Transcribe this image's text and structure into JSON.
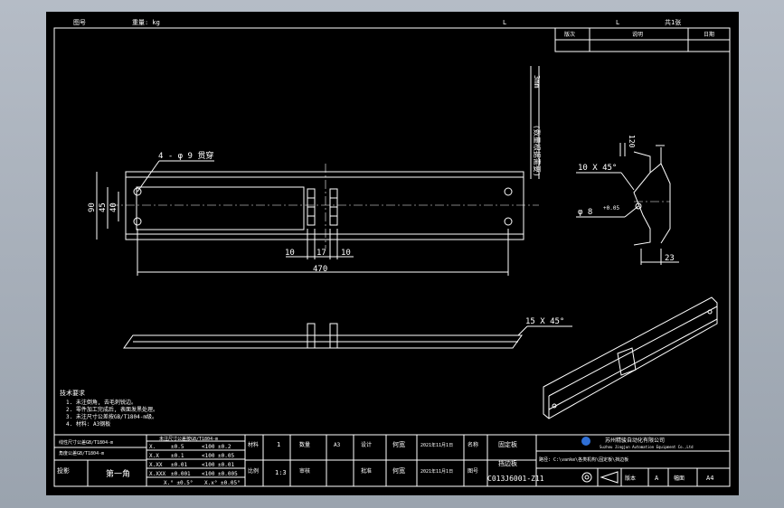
{
  "app": {
    "name": "CAD drawing viewport"
  },
  "header": {
    "left_label": "图号",
    "weight_label": "重量: kg",
    "mark_l1": "L",
    "mark_l2": "L",
    "sheet_label": "共1张"
  },
  "revision_table": {
    "headers": [
      "版次",
      "说明",
      "日期"
    ]
  },
  "part_views": {
    "side_dim": "3mm",
    "side_note": "(数量根据需要)",
    "hole_note": "4 - φ 9 贯穿",
    "dim_90": "90",
    "dim_45": "45",
    "dim_40": "40",
    "dim_10a": "10",
    "dim_17": "17",
    "dim_10b": "10",
    "dim_470": "470",
    "chamfer_10": "10 X 45°",
    "dia_8": "φ 8",
    "tol_8": "+0.05",
    "dim_23": "23",
    "dim_top": "120",
    "chamfer_15": "15 X 45°"
  },
  "notes": {
    "title": "技术要求",
    "lines": [
      "1. 未注倒角, 去毛刺锐边。",
      "2. 零件加工完成后, 表面发黑处理。",
      "3. 未注尺寸公差按GB/T1804-m级。",
      "4. 材料: A3钢板"
    ]
  },
  "title_block": {
    "tolerance_header": "未注尺寸公差按GB/T1804-m",
    "left_rows": [
      "线性尺寸公差GB/T1804-m",
      "角度公差GB/T1804-m"
    ],
    "tolerance_rows": [
      [
        "X.",
        "±0.5",
        "<100 ±0.2"
      ],
      [
        "X.X",
        "±0.1",
        "<100 ±0.05"
      ],
      [
        "X.XX",
        "±0.01",
        "<100 ±0.01"
      ],
      [
        "X.XXX",
        "±0.001",
        "<100 ±0.005"
      ]
    ],
    "angle_row": [
      "X.° ±0.5°",
      "X.x° ±0.05°"
    ],
    "proj_label": "投影",
    "proj_value": "第一角",
    "material_label": "材料",
    "material_value": "A3",
    "scale_label": "比例",
    "scale_value": "1:3",
    "qty_label": "数量",
    "qty_value": "1",
    "design_label": "设计",
    "design_name": "何宽",
    "design_date": "2021年11月1日",
    "check_label": "审核",
    "check_name": "何宽",
    "check_date": "2021年11月1日",
    "approve_label": "批准",
    "name_label": "名称",
    "part_name": "固定板",
    "part_name2": "挡边板",
    "company": "苏州精骏自动化有限公司",
    "company_en": "Suzhou Jingjun Automation Equipment Co.,Ltd",
    "drawing_path": "路径: C:\\vanke\\各类机构\\固定板\\挡边板",
    "drawing_no_label": "图号",
    "drawing_no": "C013J6001-Z11",
    "version_label": "版本",
    "version_value": "A",
    "size_label": "幅面",
    "size_value": "A4"
  }
}
